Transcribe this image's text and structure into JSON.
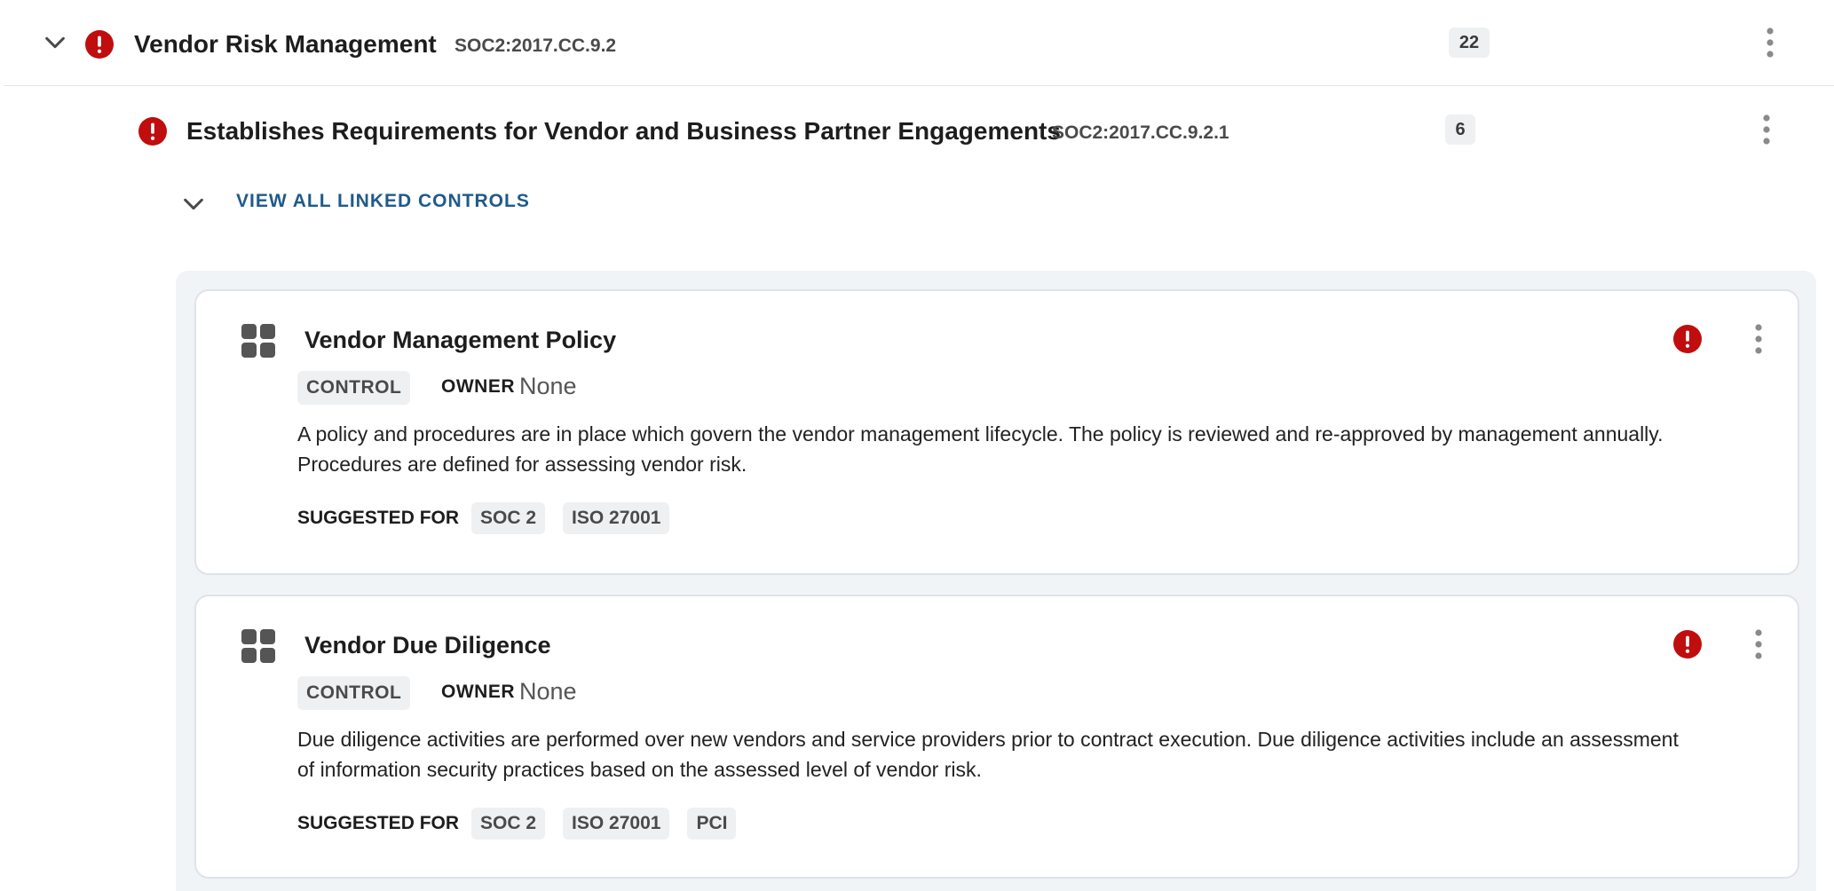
{
  "requirement": {
    "title": "Vendor Risk Management",
    "code": "SOC2:2017.CC.9.2",
    "count": "22"
  },
  "sub_requirement": {
    "title": "Establishes Requirements for Vendor and Business Partner Engagements",
    "code": "SOC2:2017.CC.9.2.1",
    "count": "6"
  },
  "view_all_label": "VIEW ALL LINKED CONTROLS",
  "controls": [
    {
      "title": "Vendor Management Policy",
      "type": "CONTROL",
      "owner_label": "OWNER",
      "owner_value": "None",
      "description": "A policy and procedures are in place which govern the vendor management lifecycle. The policy is reviewed and re-approved by management annually. Procedures are defined for assessing vendor risk.",
      "suggested_label": "SUGGESTED FOR",
      "suggested_for": [
        "SOC 2",
        "ISO 27001"
      ]
    },
    {
      "title": "Vendor Due Diligence",
      "type": "CONTROL",
      "owner_label": "OWNER",
      "owner_value": "None",
      "description": "Due diligence activities are performed over new vendors and service providers prior to contract execution. Due diligence activities include an assessment of information security practices based on the assessed level of vendor risk.",
      "suggested_label": "SUGGESTED FOR",
      "suggested_for": [
        "SOC 2",
        "ISO 27001",
        "PCI"
      ]
    }
  ],
  "icons": {
    "expand": "chevron-down-icon",
    "alert": "alert-circle-icon",
    "menu": "more-vertical-icon",
    "control": "grid-icon"
  },
  "colors": {
    "alert": "#c00d0d",
    "link": "#1f5a8a",
    "chip_bg": "#eef0f2",
    "panel_bg": "#f1f4f7"
  }
}
